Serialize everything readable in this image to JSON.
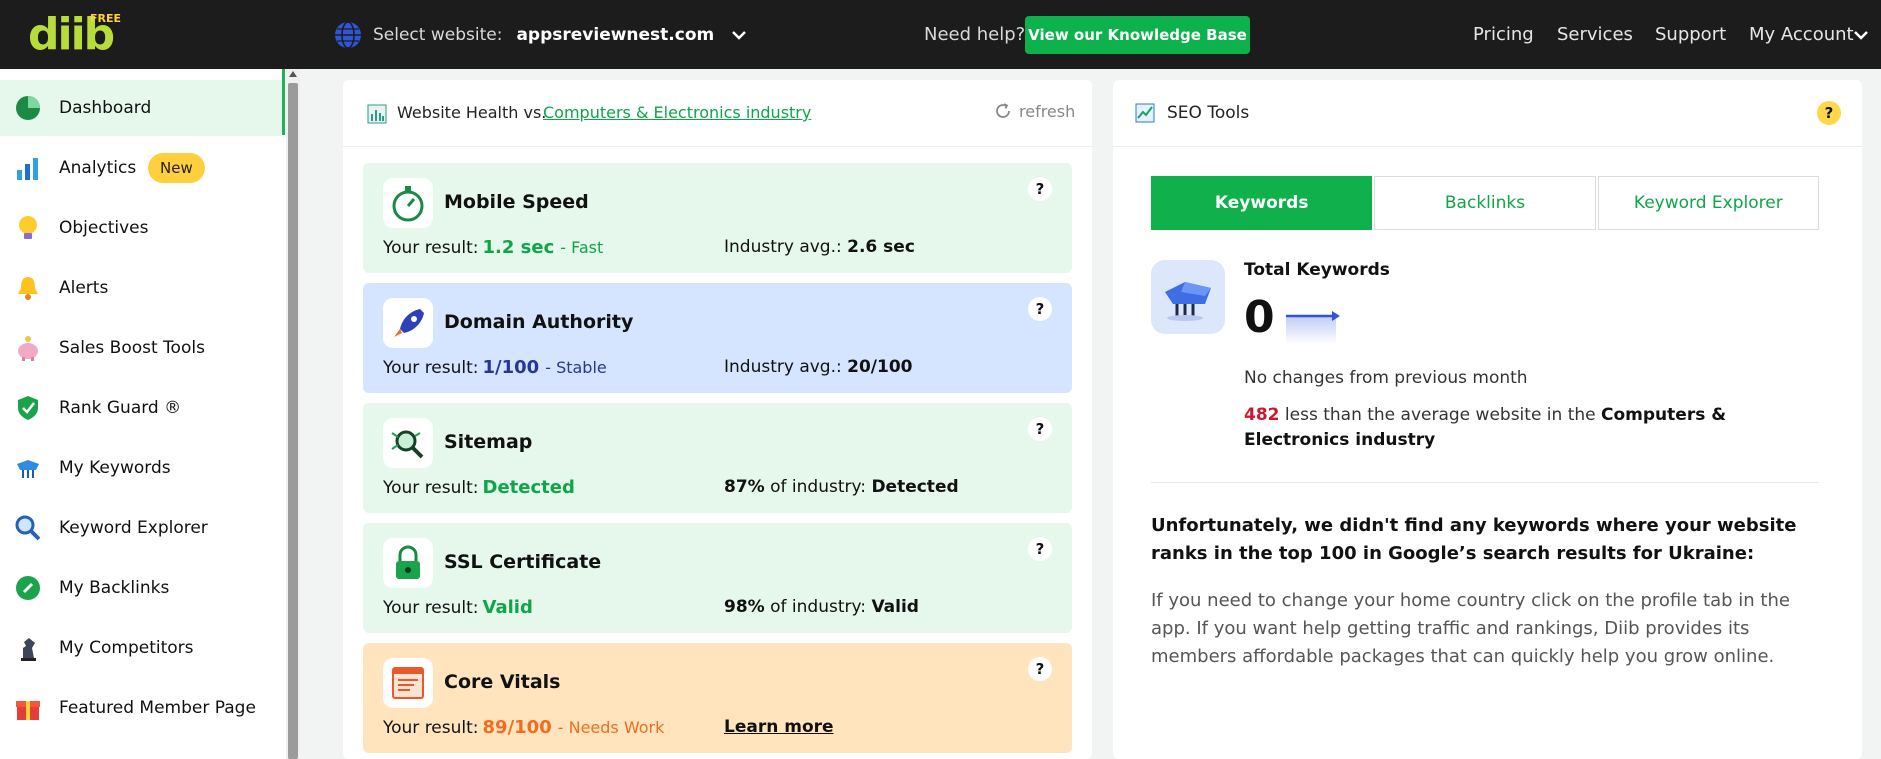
{
  "topbar": {
    "logo_text": "diib",
    "logo_badge": "FREE",
    "select_label": "Select website:",
    "site_name": "appsreviewnest.com",
    "help_text": "Need help?",
    "kb_button": "View our Knowledge Base",
    "nav": [
      "Pricing",
      "Services",
      "Support",
      "My Account"
    ]
  },
  "sidebar": {
    "items": [
      {
        "label": "Dashboard",
        "icon": "dashboard-icon"
      },
      {
        "label": "Analytics",
        "icon": "analytics-icon",
        "badge": "New"
      },
      {
        "label": "Objectives",
        "icon": "lightbulb-icon"
      },
      {
        "label": "Alerts",
        "icon": "bell-icon"
      },
      {
        "label": "Sales Boost Tools",
        "icon": "piggy-bank-icon"
      },
      {
        "label": "Rank Guard ®",
        "icon": "shield-icon"
      },
      {
        "label": "My Keywords",
        "icon": "keywords-icon"
      },
      {
        "label": "Keyword Explorer",
        "icon": "magnifier-icon"
      },
      {
        "label": "My Backlinks",
        "icon": "link-icon"
      },
      {
        "label": "My Competitors",
        "icon": "chess-knight-icon"
      },
      {
        "label": "Featured Member Page",
        "icon": "gift-icon"
      }
    ]
  },
  "health": {
    "title": "Website Health vs.",
    "industry_link": "Computers & Electronics industry",
    "refresh": "refresh",
    "result_label": "Your result:",
    "cards": [
      {
        "title": "Mobile Speed",
        "value": "1.2 sec",
        "status": "- Fast",
        "ind_label": "Industry avg.:",
        "ind_value": "2.6 sec",
        "color": "#10a548"
      },
      {
        "title": "Domain Authority",
        "value": "1/100",
        "status": "- Stable",
        "ind_label": "Industry avg.:",
        "ind_value": "20/100",
        "color": "#26369a"
      },
      {
        "title": "Sitemap",
        "value": "Detected",
        "status": "",
        "ind_pct": "87%",
        "ind_label": "of industry:",
        "ind_value": "Detected",
        "color": "#10a548"
      },
      {
        "title": "SSL Certificate",
        "value": "Valid",
        "status": "",
        "ind_pct": "98%",
        "ind_label": "of industry:",
        "ind_value": "Valid",
        "color": "#10a548"
      },
      {
        "title": "Core Vitals",
        "value": "89/100",
        "status": "- Needs Work",
        "learn_more": "Learn more",
        "color": "#f06d20"
      }
    ]
  },
  "seo": {
    "title": "SEO Tools",
    "tabs": [
      "Keywords",
      "Backlinks",
      "Keyword Explorer"
    ],
    "total_label": "Total Keywords",
    "total_value": "0",
    "change_text": "No changes from previous month",
    "diff_value": "482",
    "diff_text": "less than the average website in the",
    "diff_industry": "Computers & Electronics industry",
    "notice": "Unfortunately, we didn't find any keywords where your website ranks in the top 100 in Google’s search results for Ukraine:",
    "notice_body": "If you need to change your home country click on the profile tab in the app. If you want help getting traffic and rankings, Diib provides its members affordable packages that can quickly help you grow online."
  }
}
